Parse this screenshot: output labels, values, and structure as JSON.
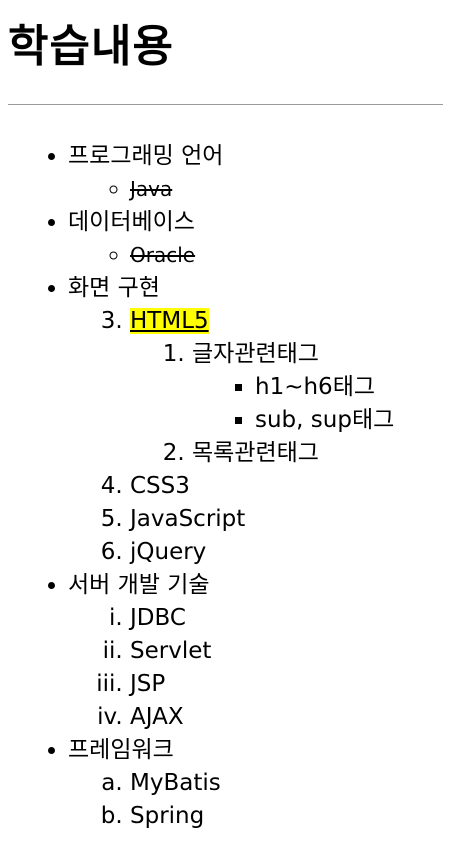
{
  "page_title": "학습내용",
  "lists": {
    "programming": {
      "label": "프로그래밍 언어",
      "items": [
        "Java"
      ]
    },
    "database": {
      "label": "데이터베이스",
      "items": [
        "Oracle"
      ]
    },
    "screen": {
      "label": "화면 구현",
      "html5": {
        "label": "HTML5",
        "text_tags": {
          "label": "글자관련태그",
          "items": [
            "h1~h6태그",
            "sub, sup태그"
          ]
        },
        "list_tags": {
          "label": "목록관련태그"
        }
      },
      "others": [
        "CSS3",
        "JavaScript",
        "jQuery"
      ]
    },
    "server": {
      "label": "서버 개발 기술",
      "items": [
        "JDBC",
        "Servlet",
        "JSP",
        "AJAX"
      ]
    },
    "framework": {
      "label": "프레임워크",
      "items": [
        "MyBatis",
        "Spring"
      ]
    }
  }
}
